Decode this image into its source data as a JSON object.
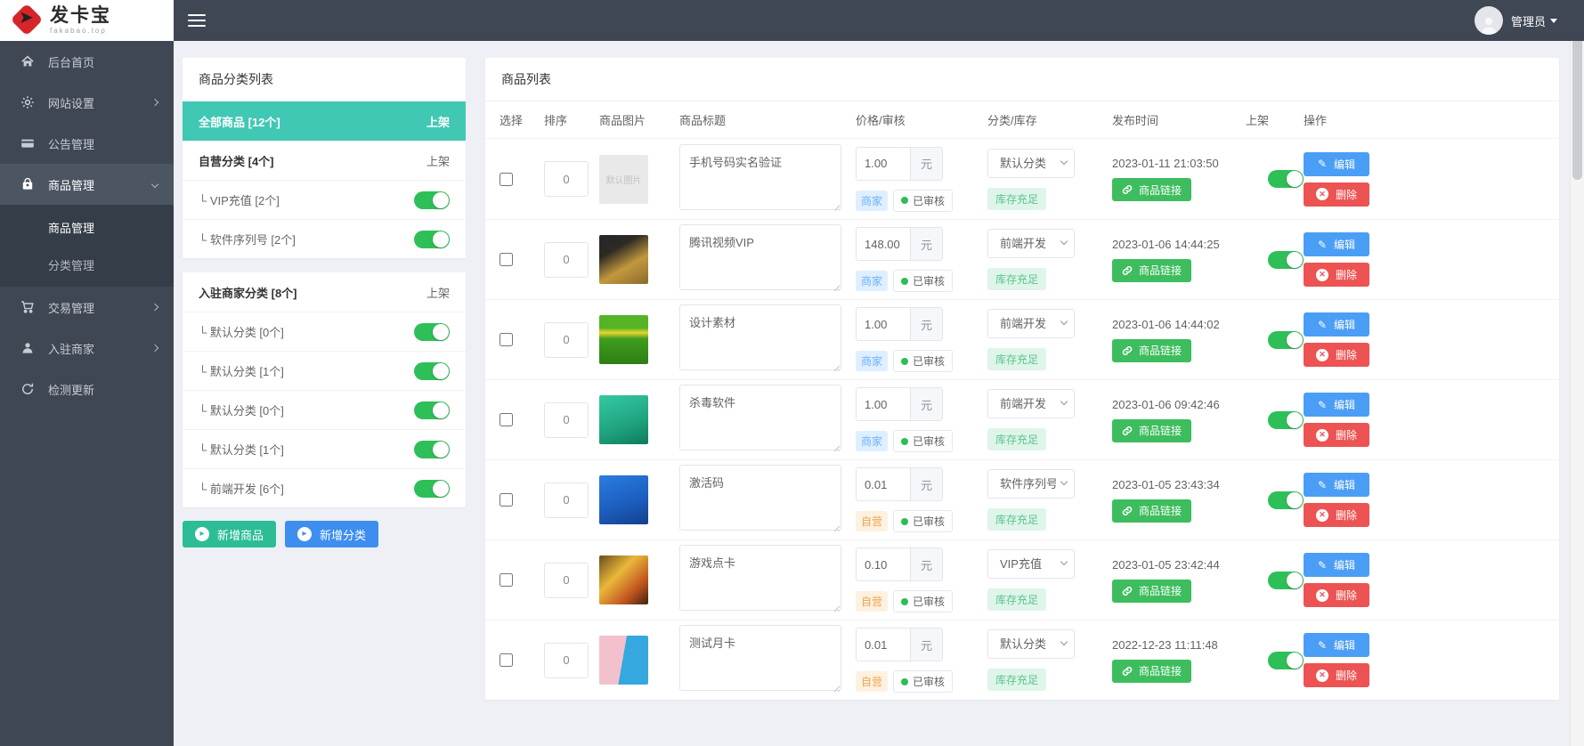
{
  "header": {
    "logo_title": "发卡宝",
    "logo_subtitle": "fakabao.top",
    "logo_arrow": "➤",
    "user": "管理员"
  },
  "sidebar": {
    "items": [
      {
        "label": "后台首页",
        "icon": "home-icon"
      },
      {
        "label": "网站设置",
        "icon": "gear-icon",
        "chevron": "right"
      },
      {
        "label": "公告管理",
        "icon": "announcement-icon"
      },
      {
        "label": "商品管理",
        "icon": "goods-icon",
        "chevron": "down",
        "active": true,
        "children": [
          {
            "label": "商品管理",
            "active": true
          },
          {
            "label": "分类管理"
          }
        ]
      },
      {
        "label": "交易管理",
        "icon": "cart-icon",
        "chevron": "right"
      },
      {
        "label": "入驻商家",
        "icon": "merchant-icon",
        "chevron": "right"
      },
      {
        "label": "检测更新",
        "icon": "update-icon"
      }
    ]
  },
  "categories": {
    "title": "商品分类列表",
    "groups": [
      {
        "rows": [
          {
            "label": "全部商品 [12个]",
            "right": "上架",
            "style": "selected"
          },
          {
            "label": "自营分类 [4个]",
            "right": "上架",
            "style": "group"
          },
          {
            "label": "└ VIP充值 [2个]",
            "toggle": true
          },
          {
            "label": "└ 软件序列号 [2个]",
            "toggle": true
          }
        ]
      },
      {
        "rows": [
          {
            "label": "入驻商家分类 [8个]",
            "right": "上架",
            "style": "group"
          },
          {
            "label": "└ 默认分类 [0个]",
            "toggle": true
          },
          {
            "label": "└ 默认分类 [1个]",
            "toggle": true
          },
          {
            "label": "└ 默认分类 [0个]",
            "toggle": true
          },
          {
            "label": "└ 默认分类 [1个]",
            "toggle": true
          },
          {
            "label": "└ 前端开发 [6个]",
            "toggle": true
          }
        ]
      }
    ],
    "add_product_label": "新增商品",
    "add_category_label": "新增分类",
    "add_icon": "▸"
  },
  "products": {
    "title": "商品列表",
    "columns": [
      "选择",
      "排序",
      "商品图片",
      "商品标题",
      "价格/审核",
      "分类/库存",
      "发布时间",
      "上架",
      "操作"
    ],
    "unit": "元",
    "link_label": "商品链接",
    "edit_label": "编辑",
    "delete_label": "删除",
    "rows": [
      {
        "sort": "0",
        "image": {
          "kind": "placeholder",
          "label": "默认图片"
        },
        "title": "手机号码实名验证",
        "price": "1.00",
        "seller": "商家",
        "seller_type": "merchant",
        "audit": "已审核",
        "category": "默认分类",
        "stock": "库存充足",
        "time": "2023-01-11 21:03:50",
        "on": true
      },
      {
        "sort": "0",
        "image": {
          "kind": "gold-card",
          "label": ""
        },
        "title": "腾讯视频VIP",
        "price": "148.00",
        "seller": "商家",
        "seller_type": "merchant",
        "audit": "已审核",
        "category": "前端开发",
        "stock": "库存充足",
        "time": "2023-01-06 14:44:25",
        "on": true
      },
      {
        "sort": "0",
        "image": {
          "kind": "green-font",
          "label": ""
        },
        "title": "设计素材",
        "price": "1.00",
        "seller": "商家",
        "seller_type": "merchant",
        "audit": "已审核",
        "category": "前端开发",
        "stock": "库存充足",
        "time": "2023-01-06 14:44:02",
        "on": true
      },
      {
        "sort": "0",
        "image": {
          "kind": "teal-av",
          "label": ""
        },
        "title": "杀毒软件",
        "price": "1.00",
        "seller": "商家",
        "seller_type": "merchant",
        "audit": "已审核",
        "category": "前端开发",
        "stock": "库存充足",
        "time": "2023-01-06 09:42:46",
        "on": true
      },
      {
        "sort": "0",
        "image": {
          "kind": "blue-win",
          "label": ""
        },
        "title": "激活码",
        "price": "0.01",
        "seller": "自营",
        "seller_type": "self",
        "audit": "已审核",
        "category": "软件序列号",
        "stock": "库存充足",
        "time": "2023-01-05 23:43:34",
        "on": true
      },
      {
        "sort": "0",
        "image": {
          "kind": "game-card",
          "label": ""
        },
        "title": "游戏点卡",
        "price": "0.10",
        "seller": "自营",
        "seller_type": "self",
        "audit": "已审核",
        "category": "VIP充值",
        "stock": "库存充足",
        "time": "2023-01-05 23:42:44",
        "on": true
      },
      {
        "sort": "0",
        "image": {
          "kind": "month-card",
          "label": ""
        },
        "title": "测试月卡",
        "price": "0.01",
        "seller": "自营",
        "seller_type": "self",
        "audit": "已审核",
        "category": "默认分类",
        "stock": "库存充足",
        "time": "2022-12-23 11:11:48",
        "on": true
      }
    ]
  },
  "colors": {
    "accent_teal": "#41c8b4",
    "toggle_green": "#2fbf58",
    "link_green": "#3dbd5e",
    "edit_blue": "#4b9ef5",
    "delete_red": "#ec5352",
    "add_product_teal": "#2dbd96",
    "add_category_blue": "#3e8ef0",
    "sidebar_dark": "#3f4754"
  }
}
